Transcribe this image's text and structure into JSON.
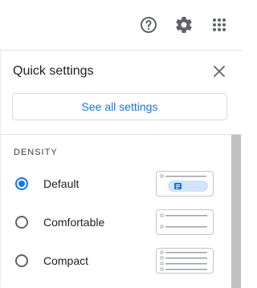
{
  "toolbar": {
    "help_icon": "help-circle",
    "settings_icon": "gear",
    "apps_icon": "apps-grid"
  },
  "quick_settings": {
    "title": "Quick settings",
    "close_icon": "close",
    "see_all_label": "See all settings"
  },
  "density": {
    "section_label": "DENSITY",
    "options": [
      {
        "label": "Default",
        "checked": true
      },
      {
        "label": "Comfortable",
        "checked": false
      },
      {
        "label": "Compact",
        "checked": false
      }
    ]
  },
  "colors": {
    "accent": "#1a73e8",
    "text": "#202124",
    "icon": "#5f6368"
  }
}
